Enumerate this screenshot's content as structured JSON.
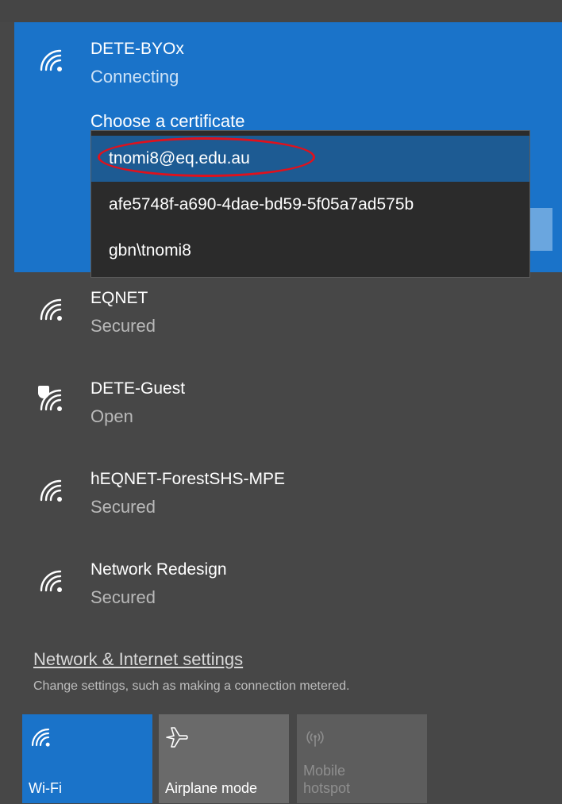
{
  "active_network": {
    "name": "DETE-BYOx",
    "status": "Connecting",
    "choose_certificate_label": "Choose a certificate",
    "icon": "wifi-icon"
  },
  "certificates": [
    {
      "label": "tnomi8@eq.edu.au",
      "selected": true
    },
    {
      "label": "afe5748f-a690-4dae-bd59-5f05a7ad575b",
      "selected": false
    },
    {
      "label": "gbn\\tnomi8",
      "selected": false
    }
  ],
  "networks": [
    {
      "name": "EQNET",
      "status": "Secured",
      "icon": "wifi-icon"
    },
    {
      "name": "DETE-Guest",
      "status": "Open",
      "icon": "wifi-shield-icon"
    },
    {
      "name": "hEQNET-ForestSHS-MPE",
      "status": "Secured",
      "icon": "wifi-icon"
    },
    {
      "name": "Network Redesign",
      "status": "Secured",
      "icon": "wifi-icon"
    }
  ],
  "settings": {
    "link_text": "Network & Internet settings",
    "subtext": "Change settings, such as making a connection metered."
  },
  "quick_actions": [
    {
      "label": "Wi-Fi",
      "icon": "wifi-icon",
      "state": "on"
    },
    {
      "label": "Airplane mode",
      "icon": "airplane-icon",
      "state": "off"
    },
    {
      "label": "Mobile hotspot",
      "icon": "hotspot-icon",
      "state": "disabled"
    }
  ],
  "colors": {
    "accent": "#1a73c9",
    "panel_bg": "#474747",
    "dropdown_bg": "#2b2b2b",
    "dropdown_selected": "#1d5b93",
    "highlight_ring": "#e0111c"
  }
}
